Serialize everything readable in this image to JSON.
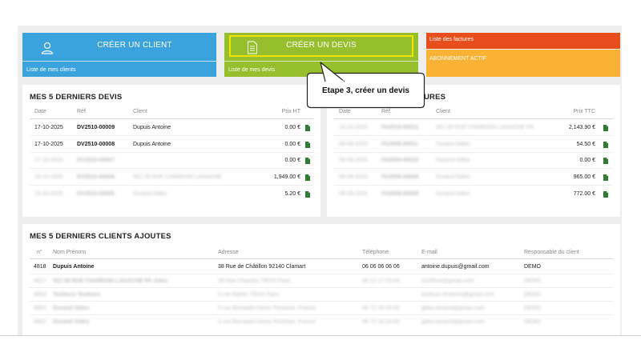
{
  "tiles": {
    "client": {
      "title": "CRÉER UN CLIENT",
      "link": "Liste de mes clients",
      "color": "#3aa3dd"
    },
    "devis": {
      "title": "CRÉER UN DEVIS",
      "link": "Liste de mes devis",
      "color": "#95bf2d",
      "highlight": "#f2e300"
    },
    "factures": {
      "link": "Liste des factures",
      "color": "#e74e1b"
    },
    "abonnement": {
      "status": "ABONNEMENT ACTIF",
      "color": "#f9b233"
    }
  },
  "callout": {
    "text": "Etape 3, créer un devis"
  },
  "devis_panel": {
    "title": "MES 5 DERNIERS DEVIS",
    "headers": {
      "date": "Date",
      "ref": "Réf.",
      "client": "Client",
      "price": "Prix HT"
    },
    "rows": [
      {
        "date": "17-10-2025",
        "ref": "DV2510-00009",
        "client": "Dupuis Antoine",
        "price": "0.00 €"
      },
      {
        "date": "17-10-2025",
        "ref": "DV2510-00008",
        "client": "Dupuis Antoine",
        "price": "0.00 €"
      },
      {
        "date": "17-10-2025",
        "ref": "DV2510-00007",
        "client": "",
        "price": "0.00 €"
      },
      {
        "date": "16-10-2025",
        "ref": "DV2510-00006",
        "client": "SCI 28 RUE CHARDON LAGACHE",
        "price": "1,949.00 €"
      },
      {
        "date": "15-10-2025",
        "ref": "DV2510-00005",
        "client": "Durand Gilles",
        "price": "5.20 €"
      }
    ]
  },
  "factures_panel": {
    "title_visible": "URES",
    "headers": {
      "date": "Date",
      "ref": "Réf.",
      "client": "Client",
      "price": "Prix TTC"
    },
    "rows": [
      {
        "date": "10-10-2025",
        "ref": "FA2510-00012",
        "client": "SCI 28 RUE CHARDON LAGACHE PA",
        "price": "2,143.90 €"
      },
      {
        "date": "09-09-2025",
        "ref": "FA2509-00011",
        "client": "Durand Gilles",
        "price": "54.50 €"
      },
      {
        "date": "09-09-2025",
        "ref": "FA2509-00010",
        "client": "Durand Gilles",
        "price": "0.00 €"
      },
      {
        "date": "08-09-2025",
        "ref": "FA2509-00009",
        "client": "Durand Gilles",
        "price": "965.00 €"
      },
      {
        "date": "08-09-2025",
        "ref": "FA2509-00008",
        "client": "Durand Gilles",
        "price": "772.00 €"
      }
    ]
  },
  "clients_panel": {
    "title": "MES 5 DERNIERS CLIENTS AJOUTES",
    "headers": {
      "num": "n°",
      "name": "Nom Prénom",
      "address": "Adresse",
      "phone": "Téléphone",
      "email": "E-mail",
      "manager": "Responsable du client"
    },
    "rows": [
      {
        "num": "4818",
        "name": "Dupuis Antoine",
        "address": "38 Rue de Châtillon 92140 Clamart",
        "phone": "06 06 06 06 06",
        "email": "antoine.dupuis@gmail.com",
        "manager": "DEMO"
      },
      {
        "num": "4817",
        "name": "SCI 28 RUE CHARDON LAGACHE PA Jules",
        "address": "28 Rue Chardon 75016 Paris",
        "phone": "06 12 17 03 04",
        "email": "sci28rue@gmail.com",
        "manager": "DEMO"
      },
      {
        "num": "4803",
        "name": "Testeurs Testeurs",
        "address": "5 rue Martin 75010 Paris",
        "phone": "",
        "email": "testeurs.testeurs@gmail.com",
        "manager": "DEMO"
      },
      {
        "num": "4802",
        "name": "Durand Gilles",
        "address": "5 rue Bernadet Dorez Pontoise, France",
        "phone": "06 72 18 03 00",
        "email": "gilles.durand@gmail.com",
        "manager": "DEMO"
      },
      {
        "num": "4801",
        "name": "Durand Gilles",
        "address": "5 rue Bernadet Dorez Pontoise, France",
        "phone": "06 72 18 03 00",
        "email": "gilles.durand@gmail.com",
        "manager": "DEMO"
      }
    ]
  }
}
